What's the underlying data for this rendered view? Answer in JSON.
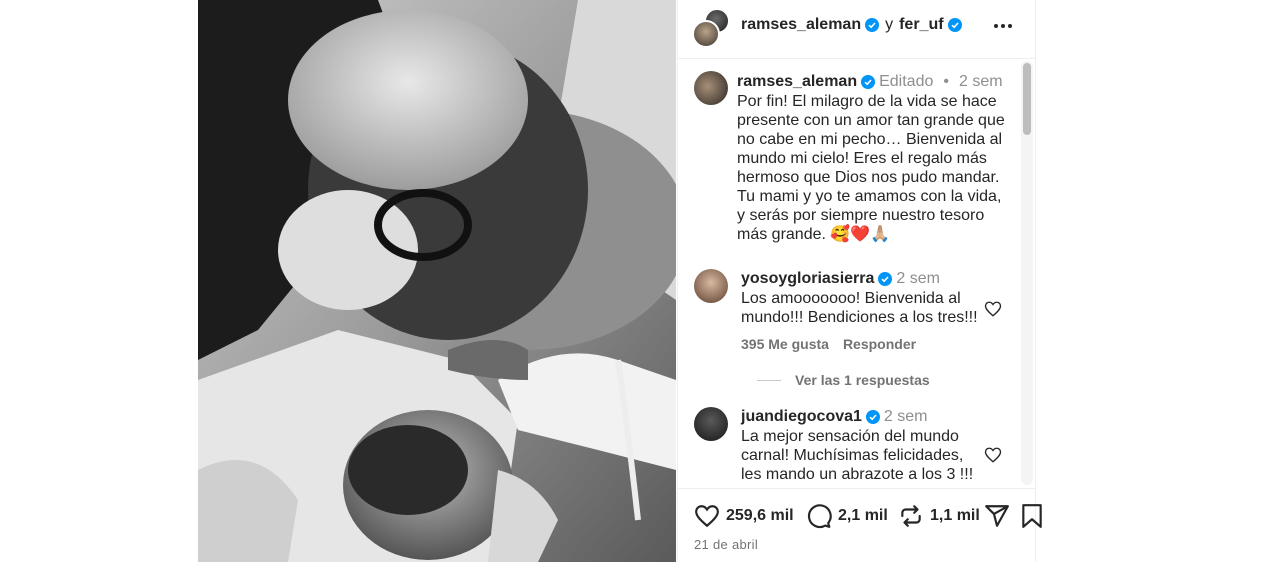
{
  "header": {
    "user1": "ramses_aleman",
    "conjunction": "y",
    "user2": "fer_uf"
  },
  "caption": {
    "username": "ramses_aleman",
    "edited": "Editado",
    "separator": "•",
    "time": "2 sem",
    "text": "Por fin! El milagro de la vida se hace presente con un amor tan grande que no cabe en mi pecho… Bienvenida al mundo mi cielo! Eres el regalo más hermoso que Dios nos pudo mandar. Tu mami y yo te amamos con la vida, y serás por siempre nuestro tesoro más grande. 🥰❤️🙏🏼"
  },
  "comments": [
    {
      "username": "yosoygloriasierra",
      "time": "2 sem",
      "text": "Los amooooooo! Bienvenida al mundo!!! Bendiciones a los tres!!!",
      "likes": "395 Me gusta",
      "reply": "Responder",
      "view_replies": "Ver las 1 respuestas"
    },
    {
      "username": "juandiegocova1",
      "time": "2 sem",
      "text": "La mejor sensación del mundo carnal! Muchísimas felicidades, les mando un abrazote a los 3 !!!"
    }
  ],
  "actions": {
    "likes": "259,6 mil",
    "comments": "2,1 mil",
    "reposts": "1,1 mil"
  },
  "date": "21 de abril",
  "colors": {
    "verified": "#0095f6",
    "text": "#262626",
    "muted": "#737373"
  },
  "icons": [
    "more-options-icon",
    "verified-badge-icon",
    "heart-icon",
    "comment-icon",
    "repost-icon",
    "share-icon",
    "bookmark-icon"
  ]
}
